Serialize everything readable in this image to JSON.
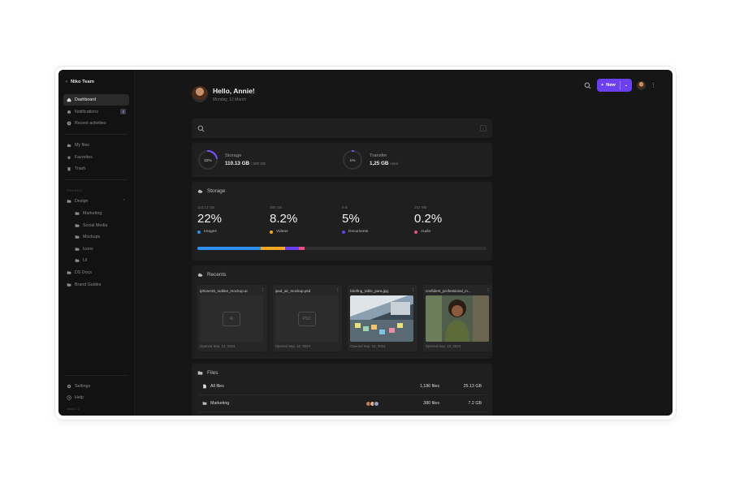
{
  "sidebar": {
    "team": "Niko Team",
    "nav": [
      {
        "label": "Dashboard",
        "icon": "home-icon",
        "active": true
      },
      {
        "label": "Notifications",
        "icon": "bell-icon",
        "badge": "2"
      },
      {
        "label": "Recent activities",
        "icon": "clock-icon"
      }
    ],
    "files_nav": [
      {
        "label": "My files",
        "icon": "cloud-icon"
      },
      {
        "label": "Favorites",
        "icon": "star-icon"
      },
      {
        "label": "Trash",
        "icon": "trash-icon"
      }
    ],
    "section_label": "SHARED",
    "design": {
      "label": "Design",
      "icon": "folder-icon"
    },
    "design_children": [
      "Marketing",
      "Social Media",
      "Mockups",
      "Icons",
      "UI"
    ],
    "other_folders": [
      "DS Docs",
      "Brand Guides"
    ],
    "bottom": [
      {
        "label": "Settings",
        "icon": "gear-icon"
      },
      {
        "label": "Help",
        "icon": "help-icon"
      }
    ],
    "version": "Vault 1.1"
  },
  "topbar": {
    "new_label": "New"
  },
  "greeting": {
    "title": "Hello, Annie!",
    "date": "Monday, 12 March"
  },
  "search": {
    "placeholder": "",
    "shortcut": "/"
  },
  "usage": {
    "storage": {
      "label": "Storage",
      "percent_text": "22%",
      "used": "110.13 GB",
      "total": "/ 500 GB",
      "fraction": 0.22
    },
    "transfer": {
      "label": "Transfer",
      "percent_text": "1%",
      "used": "1,25 GB",
      "total": "used",
      "fraction": 0.01
    }
  },
  "storage": {
    "title": "Storage",
    "items": [
      {
        "size": "110.13 GB",
        "percent": "22%",
        "label": "Images",
        "color": "#2e8ff0",
        "fraction": 0.22
      },
      {
        "size": "380 GB",
        "percent": "8.2%",
        "label": "Videos",
        "color": "#f5a623",
        "fraction": 0.082
      },
      {
        "size": "0 B",
        "percent": "5%",
        "label": "Documents",
        "color": "#6b3ff2",
        "fraction": 0.05
      },
      {
        "size": "252 MB",
        "percent": "0.2%",
        "label": "Audio",
        "color": "#ec4f84",
        "fraction": 0.02
      }
    ],
    "bar_bg": "#2f2f2f"
  },
  "recents": {
    "title": "Recents",
    "items": [
      {
        "name": "iphone15_outline_mockup.ai",
        "type": "AI",
        "opened": "Opened Sep. 12, 2024",
        "thumb": "file"
      },
      {
        "name": "ipad_air_mockup.psd",
        "type": "PSD",
        "opened": "Opened Sep. 12, 2024",
        "thumb": "file"
      },
      {
        "name": "briefing_table_para.jpg",
        "type": "",
        "opened": "Opened Sep. 12, 2024",
        "thumb": "photo-table"
      },
      {
        "name": "confident_professional_in...",
        "type": "",
        "opened": "Opened Sep. 12, 2024",
        "thumb": "photo-person"
      }
    ]
  },
  "files": {
    "title": "Files",
    "rows": [
      {
        "name": "All files",
        "icon": "file-icon",
        "count": "1,186 files",
        "size": "25.13 GB"
      },
      {
        "name": "Marketing",
        "icon": "folder-icon",
        "count": "380 files",
        "size": "7.2 GB"
      }
    ]
  },
  "colors": {
    "accent": "#6b3ff2",
    "bg": "#161616",
    "card": "#1f1f1f"
  }
}
